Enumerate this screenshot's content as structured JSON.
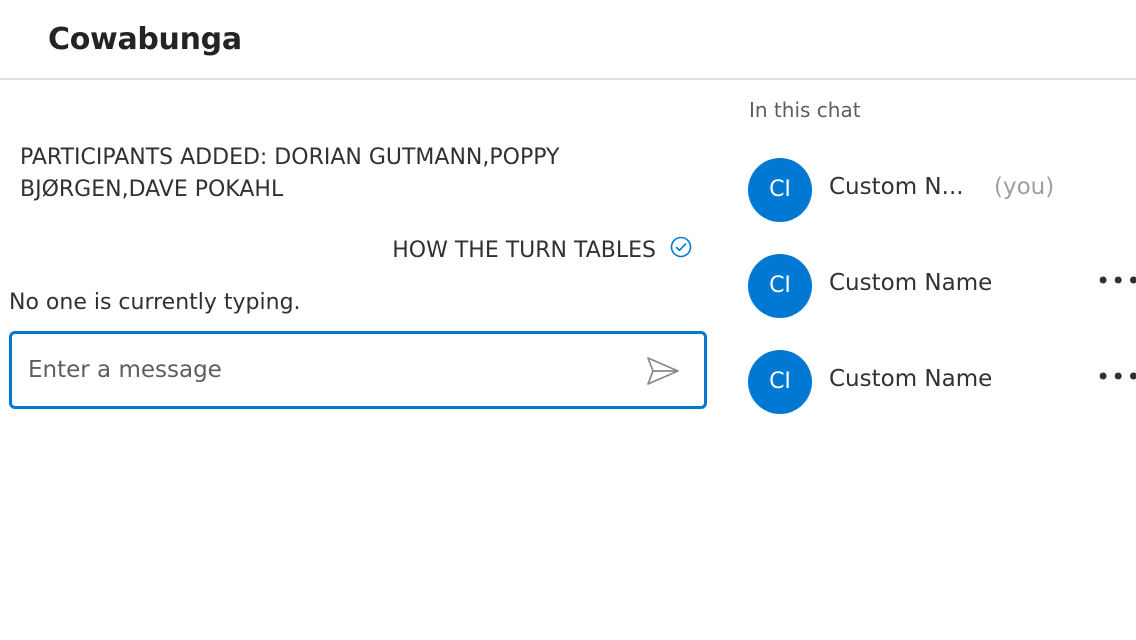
{
  "header": {
    "title": "Cowabunga"
  },
  "chat": {
    "system_message": "PARTICIPANTS ADDED: DORIAN GUTMANN,POPPY BJØRGEN,DAVE POKAHL",
    "my_message": "HOW THE TURN TABLES",
    "my_message_status_icon": "read-check-icon",
    "typing_indicator": "No one is currently typing.",
    "composer": {
      "placeholder": "Enter a message",
      "value": "",
      "send_icon": "send-icon"
    }
  },
  "people": {
    "heading": "In this chat",
    "participants": [
      {
        "initials": "CI",
        "name": "Custom N...",
        "you_label": "(you)"
      },
      {
        "initials": "CI",
        "name": "Custom Name",
        "more_icon": "more-options-icon",
        "more_glyph": "•••"
      },
      {
        "initials": "CI",
        "name": "Custom Name",
        "more_icon": "more-options-icon",
        "more_glyph": "•••"
      }
    ]
  },
  "colors": {
    "accent": "#0078d4",
    "text": "#323130",
    "muted": "#605e5c",
    "you_label": "#a19f9d",
    "divider": "#e1dfdd"
  }
}
